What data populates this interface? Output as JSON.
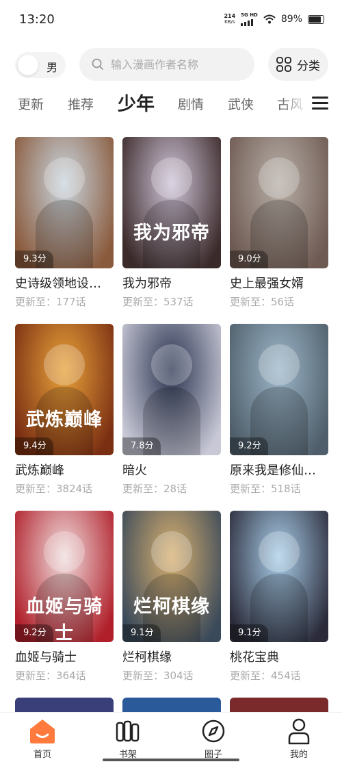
{
  "status_bar": {
    "time": "13:20",
    "net_speed_value": "214",
    "net_speed_unit": "KB/s",
    "signal_label": "5G HD",
    "battery": "89%"
  },
  "search_row": {
    "gender_label": "男",
    "search_placeholder": "输入漫画作者名称",
    "category_label": "分类"
  },
  "tabs": [
    {
      "label": "更新",
      "active": false
    },
    {
      "label": "推荐",
      "active": false
    },
    {
      "label": "少年",
      "active": true
    },
    {
      "label": "剧情",
      "active": false
    },
    {
      "label": "武侠",
      "active": false
    },
    {
      "label": "古风",
      "active": false
    }
  ],
  "comics": [
    {
      "name": "史诗级领地设…",
      "score": "9.3分",
      "update": "更新至：177话",
      "cover_text": "",
      "colors": [
        "#c9d5de",
        "#8a5a3c"
      ]
    },
    {
      "name": "我为邪帝",
      "score": "",
      "update": "更新至：537话",
      "cover_text": "我为邪帝",
      "colors": [
        "#cfc4d8",
        "#3b2a2a"
      ]
    },
    {
      "name": "史上最强女婿",
      "score": "9.0分",
      "update": "更新至：56话",
      "cover_text": "",
      "colors": [
        "#b8b0a8",
        "#6e5a52"
      ]
    },
    {
      "name": "武炼巅峰",
      "score": "9.4分",
      "update": "更新至：3824话",
      "cover_text": "武炼巅峰",
      "colors": [
        "#e8a23a",
        "#7a2e12"
      ]
    },
    {
      "name": "暗火",
      "score": "7.8分",
      "update": "更新至：28话",
      "cover_text": "",
      "colors": [
        "#2a3450",
        "#c8c8d6"
      ]
    },
    {
      "name": "原来我是修仙…",
      "score": "9.2分",
      "update": "更新至：518话",
      "cover_text": "",
      "colors": [
        "#9cb6c8",
        "#4f5e6a"
      ]
    },
    {
      "name": "血姬与骑士",
      "score": "9.2分",
      "update": "更新至：364话",
      "cover_text": "血姬与骑士",
      "colors": [
        "#f0dede",
        "#b01f2a"
      ]
    },
    {
      "name": "烂柯棋缘",
      "score": "9.1分",
      "update": "更新至：304话",
      "cover_text": "烂柯棋缘",
      "colors": [
        "#d8b070",
        "#3b4a5a"
      ]
    },
    {
      "name": "桃花宝典",
      "score": "9.1分",
      "update": "更新至：454话",
      "cover_text": "",
      "colors": [
        "#a8cde8",
        "#2b2b3a"
      ]
    }
  ],
  "partial_row_colors": [
    "#3a3f7a",
    "#2a5a9a",
    "#7a2a2a"
  ],
  "bottom_nav": [
    {
      "label": "首页",
      "icon": "home-icon",
      "active": true
    },
    {
      "label": "书架",
      "icon": "bookshelf-icon",
      "active": false
    },
    {
      "label": "圈子",
      "icon": "compass-icon",
      "active": false
    },
    {
      "label": "我的",
      "icon": "person-icon",
      "active": false
    }
  ],
  "accent_color": "#ff7a3c"
}
